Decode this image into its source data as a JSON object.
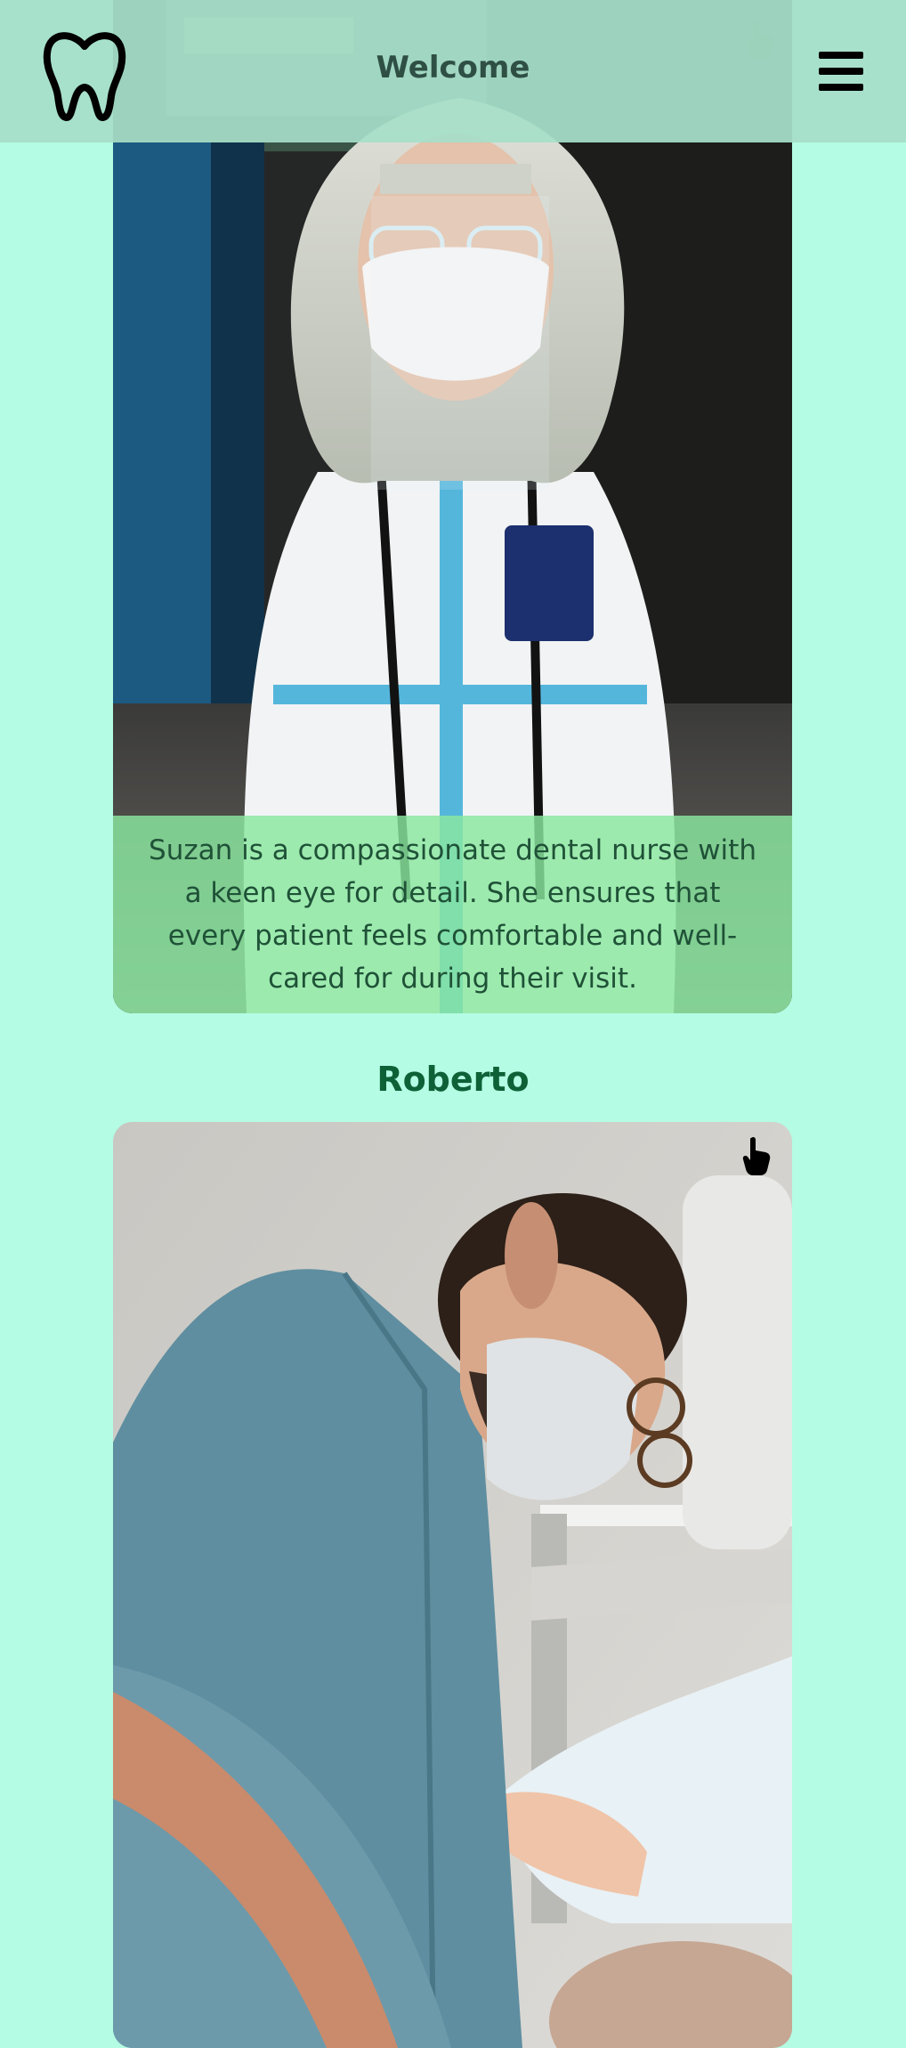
{
  "header": {
    "title": "Welcome",
    "logo_icon": "tooth-icon",
    "menu_icon": "hamburger-menu-icon"
  },
  "staff": [
    {
      "photo": "portrait of a dental nurse in protective suit, mask and face shield",
      "description": "Suzan is a compassionate dental nurse with a keen eye for detail. She ensures that every patient feels comfortable and well-cared for during their visit."
    },
    {
      "name": "Roberto",
      "photo": "dentist in blue scrubs and mask treating a patient"
    }
  ],
  "colors": {
    "page_background": "#b4fce3",
    "header_background": "#a6dec9",
    "description_overlay": "#8ae8a0",
    "name_color": "#0e6137",
    "description_text": "#1f5237"
  }
}
